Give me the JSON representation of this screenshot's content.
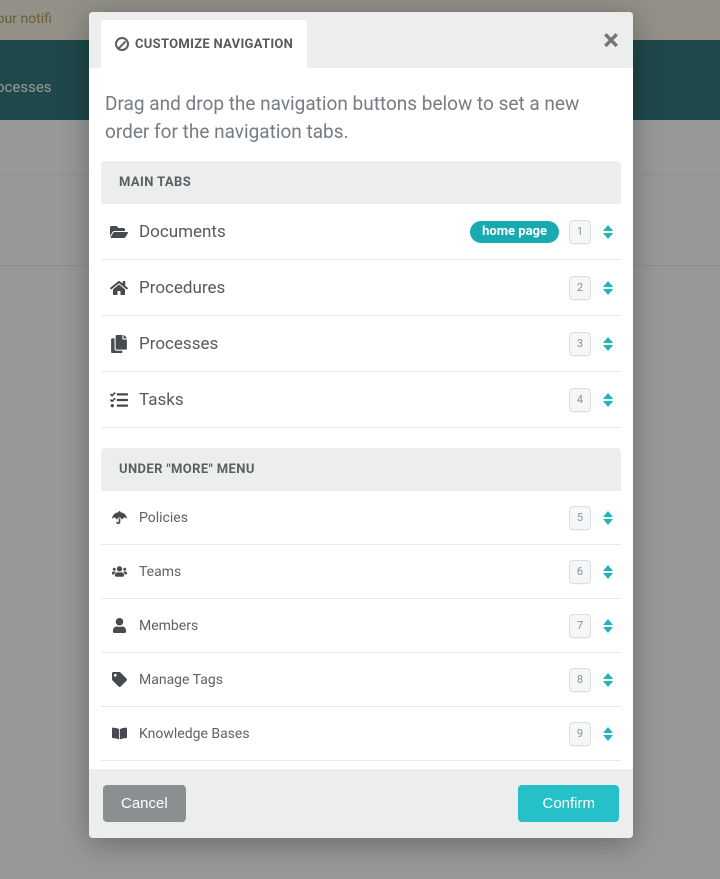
{
  "background": {
    "notif_text_fragment": "your notifi",
    "nav_text_fragment": "ocesses"
  },
  "modal": {
    "tab_label": "CUSTOMIZE NAVIGATION",
    "instructions": "Drag and drop the navigation buttons below to set a new order for the navigation tabs.",
    "section_main_label": "MAIN TABS",
    "section_more_label": "UNDER \"MORE\" MENU",
    "home_badge": "home page",
    "cancel_label": "Cancel",
    "confirm_label": "Confirm",
    "main_tabs": [
      {
        "label": "Documents",
        "order": "1",
        "home": true,
        "icon": "folder-open"
      },
      {
        "label": "Procedures",
        "order": "2",
        "home": false,
        "icon": "home"
      },
      {
        "label": "Processes",
        "order": "3",
        "home": false,
        "icon": "copy"
      },
      {
        "label": "Tasks",
        "order": "4",
        "home": false,
        "icon": "list-check"
      }
    ],
    "more_tabs": [
      {
        "label": "Policies",
        "order": "5",
        "icon": "umbrella"
      },
      {
        "label": "Teams",
        "order": "6",
        "icon": "users"
      },
      {
        "label": "Members",
        "order": "7",
        "icon": "user"
      },
      {
        "label": "Manage Tags",
        "order": "8",
        "icon": "tag"
      },
      {
        "label": "Knowledge Bases",
        "order": "9",
        "icon": "book"
      }
    ]
  }
}
